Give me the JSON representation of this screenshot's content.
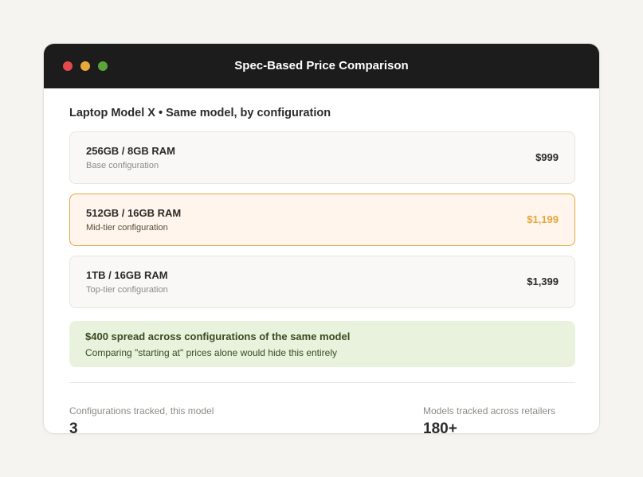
{
  "window": {
    "title": "Spec-Based Price Comparison"
  },
  "heading": "Laptop Model X • Same model, by configuration",
  "configs": [
    {
      "spec": "256GB / 8GB RAM",
      "desc": "Base configuration",
      "price": "$999"
    },
    {
      "spec": "512GB / 16GB RAM",
      "desc": "Mid-tier configuration",
      "price": "$1,199"
    },
    {
      "spec": "1TB / 16GB RAM",
      "desc": "Top-tier configuration",
      "price": "$1,399"
    }
  ],
  "summary": {
    "headline": "$400 spread across configurations of the same model",
    "note": "Comparing \"starting at\" prices alone would hide this entirely"
  },
  "stats": [
    {
      "label": "Configurations tracked, this model",
      "value": "3"
    },
    {
      "label": "Models tracked across retailers",
      "value": "180+"
    }
  ],
  "colors": {
    "titlebar": "#1c1c1c",
    "accent": "#e3a73c",
    "summary_bg": "#e8f2dc",
    "dot_red": "#e5484d",
    "dot_yellow": "#e8a93a",
    "dot_green": "#5aa43a"
  }
}
